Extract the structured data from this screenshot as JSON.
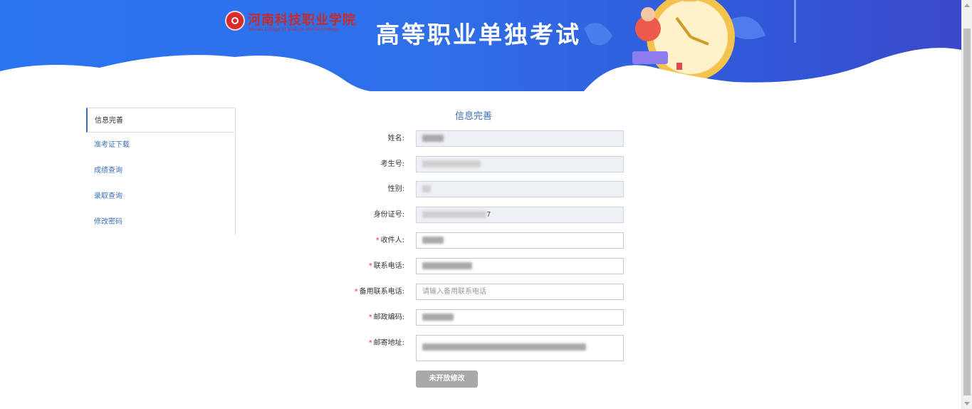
{
  "header": {
    "school_name": "河南科技职业学院",
    "school_subtitle": "Henan College of Science and Technology",
    "title": "高等职业单独考试",
    "accent_color": "#2f6fe8"
  },
  "sidebar": {
    "items": [
      {
        "label": "信息完善",
        "active": true
      },
      {
        "label": "准考证下载",
        "active": false
      },
      {
        "label": "成绩查询",
        "active": false
      },
      {
        "label": "录取查询",
        "active": false
      },
      {
        "label": "修改密码",
        "active": false
      }
    ]
  },
  "form": {
    "title": "信息完善",
    "fields": [
      {
        "label": "姓名:",
        "required": false,
        "value": "",
        "placeholder": "",
        "disabled": true
      },
      {
        "label": "考生号:",
        "required": false,
        "value": "",
        "placeholder": "",
        "disabled": true
      },
      {
        "label": "性别:",
        "required": false,
        "value": "",
        "placeholder": "",
        "disabled": true
      },
      {
        "label": "身份证号:",
        "required": false,
        "value": "7",
        "placeholder": "",
        "disabled": true
      },
      {
        "label": "收件人:",
        "required": true,
        "value": "",
        "placeholder": "",
        "disabled": false
      },
      {
        "label": "联系电话:",
        "required": true,
        "value": "",
        "placeholder": "",
        "disabled": false
      },
      {
        "label": "备用联系电话:",
        "required": true,
        "value": "",
        "placeholder": "请输入备用联系电话",
        "disabled": false
      },
      {
        "label": "邮政编码:",
        "required": true,
        "value": "",
        "placeholder": "",
        "disabled": false
      },
      {
        "label": "邮寄地址:",
        "required": true,
        "value": "",
        "placeholder": "",
        "disabled": false
      }
    ],
    "submit_label": "未开放修改",
    "required_mark": "*"
  }
}
